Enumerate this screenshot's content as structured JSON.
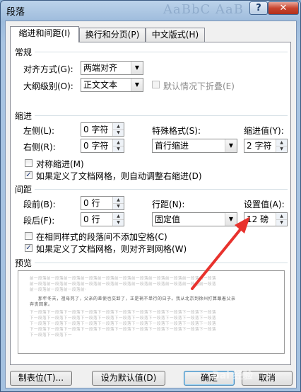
{
  "window": {
    "title": "段落",
    "ghost_text": "AaBbC  AaB",
    "help_label": "?",
    "close_label": "✕"
  },
  "tabs": [
    {
      "label": "缩进和间距(I)",
      "active": true
    },
    {
      "label": "换行和分页(P)",
      "active": false
    },
    {
      "label": "中文版式(H)",
      "active": false
    }
  ],
  "general": {
    "heading": "常规",
    "alignment_label": "对齐方式(G):",
    "alignment_value": "两端对齐",
    "outline_label": "大纲级别(O):",
    "outline_value": "正文文本",
    "collapse_label": "默认情况下折叠(E)"
  },
  "indent": {
    "heading": "缩进",
    "left_label": "左侧(L):",
    "left_value": "0 字符",
    "right_label": "右侧(R):",
    "right_value": "0 字符",
    "special_label": "特殊格式(S):",
    "special_value": "首行缩进",
    "by_label": "缩进值(Y):",
    "by_value": "2 字符",
    "mirror_label": "对称缩进(M)",
    "auto_adjust_label": "如果定义了文档网格，则自动调整右缩进(D)"
  },
  "spacing": {
    "heading": "间距",
    "before_label": "段前(B):",
    "before_value": "0 行",
    "after_label": "段后(F):",
    "after_value": "0 行",
    "line_label": "行距(N):",
    "line_value": "固定值",
    "at_label": "设置值(A):",
    "at_value": "12 磅",
    "no_space_label": "在相同样式的段落间不添加空格(C)",
    "snap_grid_label": "如果定义了文档网格，则对齐到网格(W)"
  },
  "preview": {
    "heading": "预览",
    "prev_text": "前一段落前一段落前一段落前一段落前一段落前一段落前一段落前一段落前一段落前一段落前一段落",
    "sample_line1": "那年冬天，祖母死了，父亲的差使也交卸了，正是祸不单行的日子。我从北京到徐州打算跟着父亲",
    "sample_line2": "奔丧回家。",
    "next_text": "下一段落下一段落下一段落下一段落下一段落下一段落下一段落下一段落下一段落下一段落下一段落"
  },
  "buttons": {
    "tabs": "制表位(T)...",
    "set_default": "设为默认值(D)",
    "ok": "确定",
    "cancel": "取消"
  },
  "watermark": "Bai 经验",
  "colors": {
    "annotation_arrow": "#e8322d"
  }
}
